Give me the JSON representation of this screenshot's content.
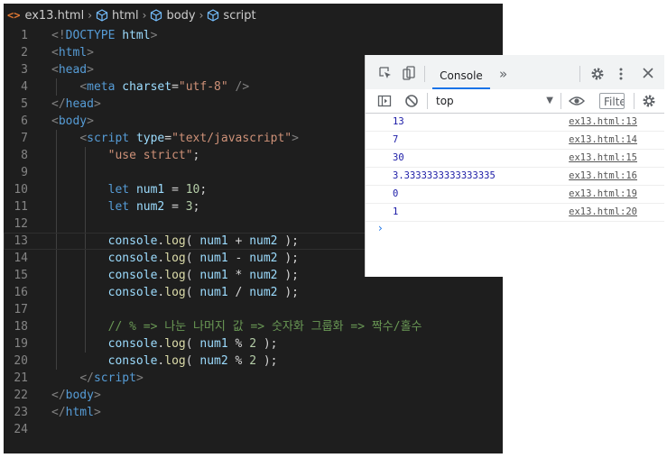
{
  "breadcrumb": {
    "file": "ex13.html",
    "path": [
      "html",
      "body",
      "script"
    ]
  },
  "code_lines": [
    {
      "n": "1",
      "tokens": [
        [
          "br",
          "<!"
        ],
        [
          "tag",
          "DOCTYPE"
        ],
        [
          "pl",
          " "
        ],
        [
          "attr",
          "html"
        ],
        [
          "br",
          ">"
        ]
      ]
    },
    {
      "n": "2",
      "tokens": [
        [
          "br",
          "<"
        ],
        [
          "tag",
          "html"
        ],
        [
          "br",
          ">"
        ]
      ]
    },
    {
      "n": "3",
      "tokens": [
        [
          "br",
          "<"
        ],
        [
          "tag",
          "head"
        ],
        [
          "br",
          ">"
        ]
      ]
    },
    {
      "n": "4",
      "tokens": [
        [
          "pl",
          "    "
        ],
        [
          "br",
          "<"
        ],
        [
          "tag",
          "meta"
        ],
        [
          "pl",
          " "
        ],
        [
          "attr",
          "charset"
        ],
        [
          "pl",
          "="
        ],
        [
          "str",
          "\"utf-8\""
        ],
        [
          "pl",
          " "
        ],
        [
          "br",
          "/>"
        ]
      ]
    },
    {
      "n": "5",
      "tokens": [
        [
          "br",
          "</"
        ],
        [
          "tag",
          "head"
        ],
        [
          "br",
          ">"
        ]
      ]
    },
    {
      "n": "6",
      "tokens": [
        [
          "br",
          "<"
        ],
        [
          "tag",
          "body"
        ],
        [
          "br",
          ">"
        ]
      ]
    },
    {
      "n": "7",
      "tokens": [
        [
          "pl",
          "    "
        ],
        [
          "br",
          "<"
        ],
        [
          "tag",
          "script"
        ],
        [
          "pl",
          " "
        ],
        [
          "attr",
          "type"
        ],
        [
          "pl",
          "="
        ],
        [
          "str",
          "\"text/javascript\""
        ],
        [
          "br",
          ">"
        ]
      ]
    },
    {
      "n": "8",
      "tokens": [
        [
          "pl",
          "        "
        ],
        [
          "str",
          "\"use strict\""
        ],
        [
          "pl",
          ";"
        ]
      ]
    },
    {
      "n": "9",
      "tokens": []
    },
    {
      "n": "10",
      "tokens": [
        [
          "pl",
          "        "
        ],
        [
          "kw",
          "let"
        ],
        [
          "pl",
          " "
        ],
        [
          "var",
          "num1"
        ],
        [
          "pl",
          " = "
        ],
        [
          "num",
          "10"
        ],
        [
          "pl",
          ";"
        ]
      ]
    },
    {
      "n": "11",
      "tokens": [
        [
          "pl",
          "        "
        ],
        [
          "kw",
          "let"
        ],
        [
          "pl",
          " "
        ],
        [
          "var",
          "num2"
        ],
        [
          "pl",
          " = "
        ],
        [
          "num",
          "3"
        ],
        [
          "pl",
          ";"
        ]
      ]
    },
    {
      "n": "12",
      "tokens": []
    },
    {
      "n": "13",
      "tokens": [
        [
          "pl",
          "        "
        ],
        [
          "var",
          "console"
        ],
        [
          "pl",
          "."
        ],
        [
          "fn",
          "log"
        ],
        [
          "pl",
          "( "
        ],
        [
          "var",
          "num1"
        ],
        [
          "pl",
          " + "
        ],
        [
          "var",
          "num2"
        ],
        [
          "pl",
          " );"
        ]
      ]
    },
    {
      "n": "14",
      "tokens": [
        [
          "pl",
          "        "
        ],
        [
          "var",
          "console"
        ],
        [
          "pl",
          "."
        ],
        [
          "fn",
          "log"
        ],
        [
          "pl",
          "( "
        ],
        [
          "var",
          "num1"
        ],
        [
          "pl",
          " - "
        ],
        [
          "var",
          "num2"
        ],
        [
          "pl",
          " );"
        ]
      ]
    },
    {
      "n": "15",
      "tokens": [
        [
          "pl",
          "        "
        ],
        [
          "var",
          "console"
        ],
        [
          "pl",
          "."
        ],
        [
          "fn",
          "log"
        ],
        [
          "pl",
          "( "
        ],
        [
          "var",
          "num1"
        ],
        [
          "pl",
          " * "
        ],
        [
          "var",
          "num2"
        ],
        [
          "pl",
          " );"
        ]
      ]
    },
    {
      "n": "16",
      "tokens": [
        [
          "pl",
          "        "
        ],
        [
          "var",
          "console"
        ],
        [
          "pl",
          "."
        ],
        [
          "fn",
          "log"
        ],
        [
          "pl",
          "( "
        ],
        [
          "var",
          "num1"
        ],
        [
          "pl",
          " / "
        ],
        [
          "var",
          "num2"
        ],
        [
          "pl",
          " );"
        ]
      ]
    },
    {
      "n": "17",
      "tokens": []
    },
    {
      "n": "18",
      "tokens": [
        [
          "pl",
          "        "
        ],
        [
          "cmt",
          "// % => 나눈 나머지 값 => 숫자화 그룹화 => 짝수/홀수"
        ]
      ]
    },
    {
      "n": "19",
      "tokens": [
        [
          "pl",
          "        "
        ],
        [
          "var",
          "console"
        ],
        [
          "pl",
          "."
        ],
        [
          "fn",
          "log"
        ],
        [
          "pl",
          "( "
        ],
        [
          "var",
          "num1"
        ],
        [
          "pl",
          " % "
        ],
        [
          "num",
          "2"
        ],
        [
          "pl",
          " );"
        ]
      ]
    },
    {
      "n": "20",
      "tokens": [
        [
          "pl",
          "        "
        ],
        [
          "var",
          "console"
        ],
        [
          "pl",
          "."
        ],
        [
          "fn",
          "log"
        ],
        [
          "pl",
          "( "
        ],
        [
          "var",
          "num2"
        ],
        [
          "pl",
          " % "
        ],
        [
          "num",
          "2"
        ],
        [
          "pl",
          " );"
        ]
      ]
    },
    {
      "n": "21",
      "tokens": [
        [
          "pl",
          "    "
        ],
        [
          "br",
          "</"
        ],
        [
          "tag",
          "script"
        ],
        [
          "br",
          ">"
        ]
      ]
    },
    {
      "n": "22",
      "tokens": [
        [
          "br",
          "</"
        ],
        [
          "tag",
          "body"
        ],
        [
          "br",
          ">"
        ]
      ]
    },
    {
      "n": "23",
      "tokens": [
        [
          "br",
          "</"
        ],
        [
          "tag",
          "html"
        ],
        [
          "br",
          ">"
        ]
      ]
    },
    {
      "n": "24",
      "tokens": []
    }
  ],
  "devtools": {
    "tab_label": "Console",
    "more_tabs_label": "»",
    "context": "top",
    "filter_placeholder": "Filte",
    "rows": [
      {
        "value": "13",
        "source": "ex13.html:13"
      },
      {
        "value": "7",
        "source": "ex13.html:14"
      },
      {
        "value": "30",
        "source": "ex13.html:15"
      },
      {
        "value": "3.3333333333333335",
        "source": "ex13.html:16"
      },
      {
        "value": "0",
        "source": "ex13.html:19"
      },
      {
        "value": "1",
        "source": "ex13.html:20"
      }
    ],
    "prompt": "›"
  },
  "colors": {
    "editor_bg": "#1e1e1e",
    "tag": "#569cd6",
    "string": "#ce9178",
    "comment": "#6a9955",
    "console_value": "#1a1aa6",
    "accent": "#1a73e8"
  },
  "icons": [
    "file-code-icon",
    "symbol-cube-icon",
    "inspect-icon",
    "device-toolbar-icon",
    "settings-icon",
    "more-icon",
    "close-icon",
    "sidebar-icon",
    "clear-console-icon",
    "eye-icon"
  ]
}
